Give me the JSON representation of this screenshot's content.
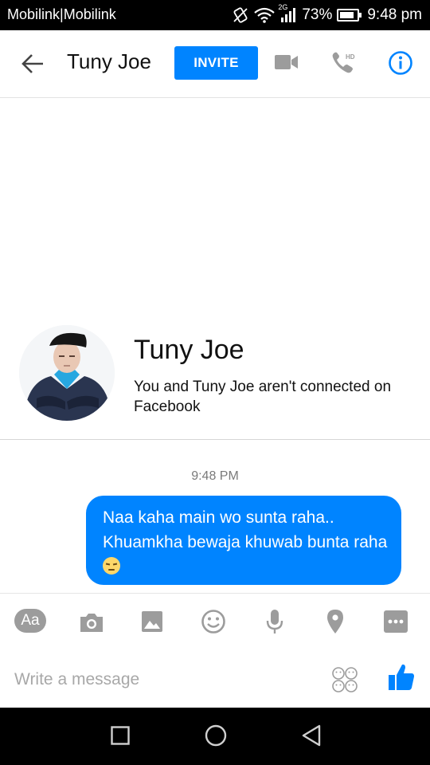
{
  "status_bar": {
    "carrier": "Mobilink|Mobilink",
    "network": "2G",
    "battery": "73%",
    "time": "9:48 pm"
  },
  "header": {
    "contact_name": "Tuny Joe",
    "invite_label": "INVITE"
  },
  "profile": {
    "name": "Tuny Joe",
    "subtitle": "You and Tuny Joe aren't connected on Facebook"
  },
  "conversation": {
    "timestamp": "9:48 PM",
    "messages": [
      {
        "text": "Naa kaha main wo sunta raha.. Khuamkha bewaja khuwab bunta raha",
        "emoji": "sleepy-face"
      }
    ]
  },
  "composer": {
    "text_button_label": "Aa",
    "placeholder": "Write a message",
    "value": ""
  },
  "colors": {
    "accent": "#0084ff",
    "icon_gray": "#9c9c9c"
  },
  "icons": [
    "back-arrow",
    "video-camera",
    "hd-phone",
    "info",
    "camera",
    "image",
    "smiley",
    "microphone",
    "location-pin",
    "more",
    "stickers",
    "thumbs-up",
    "nav-back",
    "nav-home",
    "nav-recent"
  ]
}
